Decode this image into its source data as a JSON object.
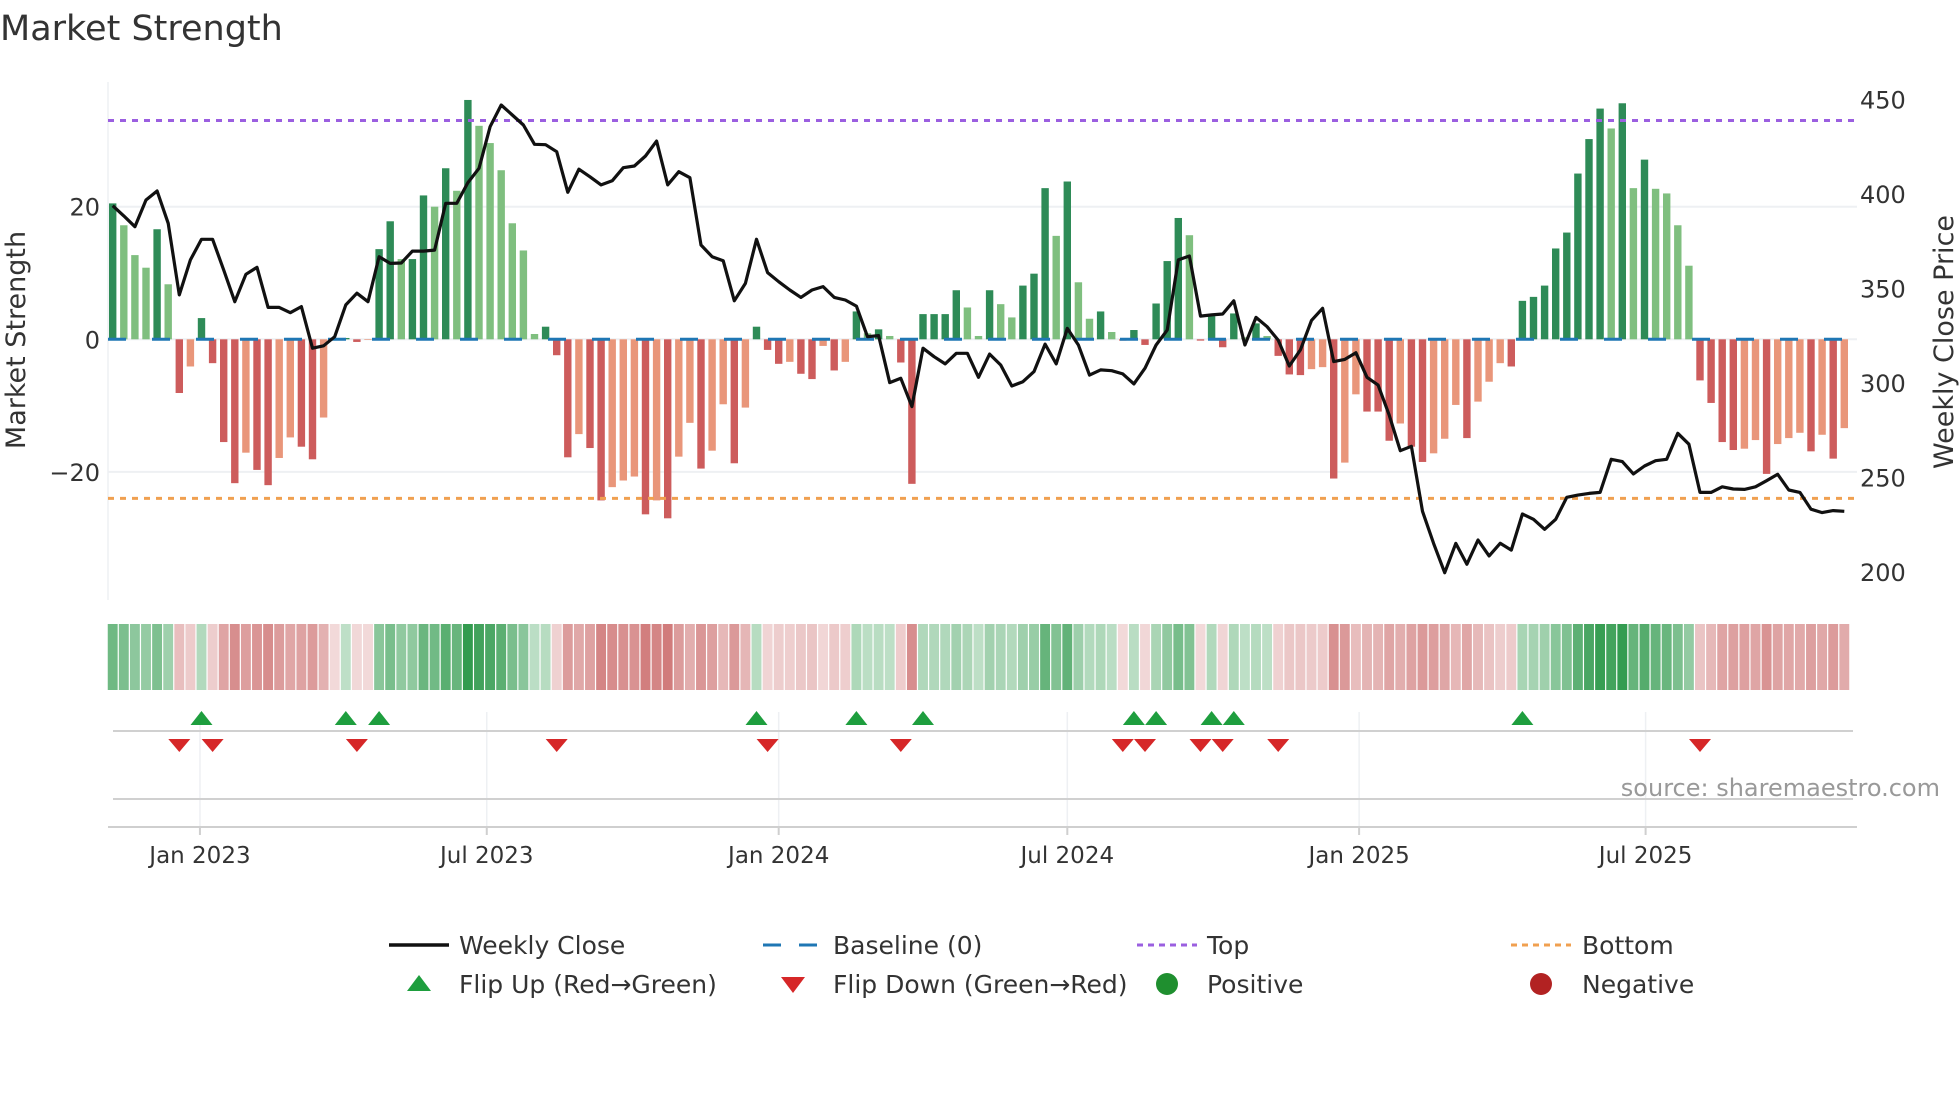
{
  "title": "Market Strength",
  "source": "source: sharemaestro.com",
  "colors": {
    "pos_up": "#2e8b57",
    "pos_down": "#7fbf7f",
    "neg_up": "#cd5c5c",
    "neg_down": "#e9967a",
    "close": "#111111",
    "baseline": "#1f77b4",
    "top": "#9b5fe0",
    "bottom": "#f0a050",
    "flip_up": "#1e9e3e",
    "flip_down": "#d62728",
    "positive": "#1f8f2f",
    "negative": "#b22222"
  },
  "legend": [
    {
      "label": "Weekly Close",
      "symbol": "line"
    },
    {
      "label": "Baseline (0)",
      "symbol": "dash"
    },
    {
      "label": "Top",
      "symbol": "dot-purple"
    },
    {
      "label": "Bottom",
      "symbol": "dot-orange"
    },
    {
      "label": "Flip Up (Red→Green)",
      "symbol": "tri-up"
    },
    {
      "label": "Flip Down (Green→Red)",
      "symbol": "tri-down"
    },
    {
      "label": "Positive",
      "symbol": "circle-green"
    },
    {
      "label": "Negative",
      "symbol": "circle-red"
    }
  ],
  "chart_data": {
    "type": "bar",
    "title": "Market Strength",
    "ylabel": "Market Strength",
    "y2label": "Weekly Close Price",
    "frequency": "weekly",
    "ylim": [
      -39.5,
      40
    ],
    "y2lim": [
      185,
      460
    ],
    "yticks": [
      {
        "value": 20,
        "label": "20"
      },
      {
        "value": 0,
        "label": "0"
      },
      {
        "value": -20,
        "label": "−20"
      }
    ],
    "y2ticks": [
      {
        "value": 450,
        "label": "450"
      },
      {
        "value": 400,
        "label": "400"
      },
      {
        "value": 350,
        "label": "350"
      },
      {
        "value": 300,
        "label": "300"
      },
      {
        "value": 250,
        "label": "250"
      },
      {
        "value": 200,
        "label": "200"
      }
    ],
    "xticks": [
      {
        "label": "Jan 2023",
        "week": 7.86
      },
      {
        "label": "Jul 2023",
        "week": 33.7
      },
      {
        "label": "Jan 2024",
        "week": 60.0
      },
      {
        "label": "Jul 2024",
        "week": 86.0
      },
      {
        "label": "Jan 2025",
        "week": 112.29
      },
      {
        "label": "Jul 2025",
        "week": 138.1
      }
    ],
    "top_level": 33,
    "bottom_level": -24,
    "strength": [
      20.5,
      17.2,
      12.7,
      10.8,
      16.6,
      8.3,
      -8.1,
      -4.1,
      3.2,
      -3.6,
      -15.5,
      -21.7,
      -17.1,
      -19.7,
      -22.0,
      -17.9,
      -14.8,
      -16.2,
      -18.1,
      -11.8,
      -0.1,
      0.2,
      -0.4,
      -0.1,
      13.6,
      17.8,
      12.1,
      12.1,
      21.7,
      20.0,
      25.8,
      22.4,
      36.1,
      32.2,
      29.6,
      25.5,
      17.5,
      13.4,
      0.8,
      1.9,
      -2.4,
      -17.8,
      -14.3,
      -16.4,
      -24.3,
      -22.3,
      -21.3,
      -20.7,
      -26.4,
      -24.3,
      -27.0,
      -17.7,
      -12.6,
      -19.5,
      -16.8,
      -9.8,
      -18.7,
      -10.3,
      1.9,
      -1.6,
      -3.7,
      -3.4,
      -5.2,
      -6.0,
      -1.0,
      -4.7,
      -3.4,
      4.2,
      0.9,
      1.5,
      0.5,
      -3.5,
      -21.8,
      3.8,
      3.8,
      3.8,
      7.4,
      4.8,
      0.5,
      7.4,
      5.3,
      3.3,
      8.1,
      9.9,
      22.8,
      15.6,
      23.8,
      8.6,
      3.1,
      4.2,
      1.1,
      -0.2,
      1.4,
      -0.85,
      5.4,
      11.8,
      18.3,
      15.7,
      -0.2,
      3.5,
      -1.2,
      3.9,
      0.3,
      2.4,
      0.5,
      -2.5,
      -5.3,
      -5.4,
      -4.5,
      -4.2,
      -21.0,
      -18.6,
      -8.3,
      -10.9,
      -10.9,
      -15.3,
      -12.7,
      -16.2,
      -18.5,
      -17.2,
      -15.0,
      -9.9,
      -14.9,
      -9.4,
      -6.4,
      -3.6,
      -4.1,
      5.8,
      6.4,
      8.1,
      13.7,
      16.1,
      25.0,
      30.2,
      34.8,
      31.8,
      35.6,
      22.8,
      27.1,
      22.7,
      22.0,
      17.2,
      11.1,
      -6.2,
      -9.6,
      -15.5,
      -16.7,
      -16.5,
      -15.2,
      -20.3,
      -15.8,
      -14.9,
      -14.1,
      -16.9,
      -14.4,
      -18.0,
      -13.4
    ],
    "weekly_close": [
      393.7,
      388.3,
      382.6,
      396.7,
      401.5,
      384.4,
      346.5,
      365,
      375.9,
      375.9,
      359.7,
      342.9,
      357.4,
      361.1,
      339.9,
      339.9,
      337.1,
      340.3,
      318.3,
      319.6,
      324.4,
      341.2,
      347.4,
      342.9,
      366.7,
      363.2,
      363.4,
      369.7,
      369.7,
      370.2,
      395,
      395,
      405.9,
      413.5,
      435.5,
      447,
      441.7,
      436.4,
      426.2,
      426,
      422.3,
      400.8,
      413,
      409,
      404.7,
      406.9,
      413.8,
      414.7,
      420,
      427.9,
      404.7,
      411.7,
      408.5,
      372.9,
      366.7,
      364.6,
      343.4,
      352.6,
      375.9,
      358.3,
      353.5,
      349.1,
      345.2,
      349.1,
      350.9,
      345.2,
      343.8,
      340.6,
      324.4,
      325,
      300.1,
      302.4,
      287.4,
      318.3,
      313.8,
      310,
      315.6,
      315.6,
      302.9,
      315.2,
      309.4,
      298.3,
      300.6,
      305.9,
      320.5,
      310,
      328.8,
      320,
      304.1,
      306.8,
      306.4,
      304.7,
      299.4,
      307.7,
      320,
      327.9,
      365,
      367.1,
      335.3,
      335.9,
      336.4,
      343.4,
      320,
      334.6,
      329.7,
      322.6,
      308.9,
      317.4,
      333,
      339.4,
      311.2,
      312.4,
      315.9,
      302.9,
      298.8,
      282.9,
      264.1,
      266.4,
      232,
      215,
      199.5,
      215,
      204,
      216.8,
      208.4,
      215.1,
      211.5,
      230.6,
      227.8,
      222.5,
      227.8,
      239.4,
      240.6,
      241.5,
      242,
      259.5,
      258.3,
      251.8,
      256,
      258.8,
      259.5,
      273.3,
      267.5,
      242,
      242,
      245,
      243.8,
      243.6,
      245,
      248.2,
      251.6,
      243.3,
      242,
      233.1,
      231.3,
      232.4,
      232
    ]
  }
}
